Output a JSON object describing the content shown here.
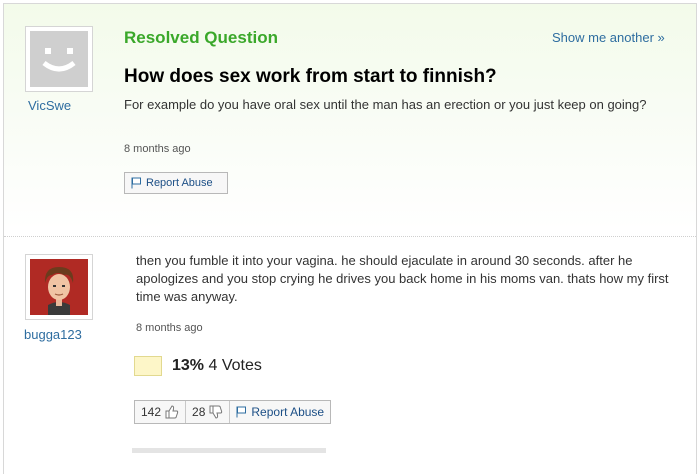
{
  "question": {
    "status": "Resolved Question",
    "show_another": "Show me another »",
    "title": "How does sex work from start to finnish?",
    "detail": "For example do you have oral sex until the man has an erection or you just keep on going?",
    "timestamp": "8 months ago",
    "asker": "VicSwe",
    "report_abuse": "Report Abuse"
  },
  "answer": {
    "author": "bugga123",
    "text": "then you fumble it into your vagina. he should ejaculate in around 30 seconds. after he apologizes and you stop crying he drives you back home in his moms van. thats how my first time was anyway.",
    "timestamp": "8 months ago",
    "vote_percent": "13%",
    "vote_count": "4 Votes",
    "thumbs_up": "142",
    "thumbs_down": "28",
    "report_abuse": "Report Abuse"
  },
  "colors": {
    "resolved_green": "#3aa82a",
    "link_blue": "#2e6da0",
    "vote_swatch": "#fdf6c8"
  },
  "icons": [
    "default-avatar-icon",
    "user-avatar",
    "flag-icon",
    "thumbs-up-icon",
    "thumbs-down-icon"
  ]
}
